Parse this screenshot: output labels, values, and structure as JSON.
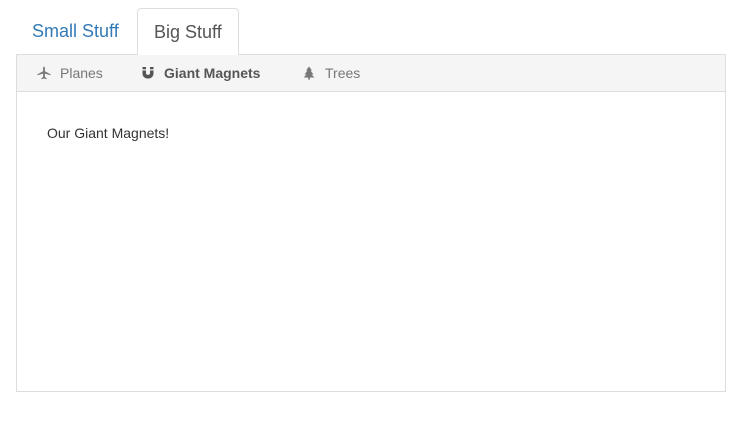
{
  "tabs": [
    {
      "label": "Small Stuff",
      "active": false
    },
    {
      "label": "Big Stuff",
      "active": true
    }
  ],
  "subnav": {
    "items": [
      {
        "label": "Planes",
        "icon": "plane-icon",
        "active": false
      },
      {
        "label": "Giant Magnets",
        "icon": "magnet-icon",
        "active": true
      },
      {
        "label": "Trees",
        "icon": "tree-icon",
        "active": false
      }
    ]
  },
  "content": {
    "text": "Our Giant Magnets!"
  },
  "colors": {
    "link": "#337ab7",
    "active_text": "#555555",
    "muted_text": "#777777",
    "subnav_bg": "#f5f5f5",
    "border": "#dddddd"
  }
}
